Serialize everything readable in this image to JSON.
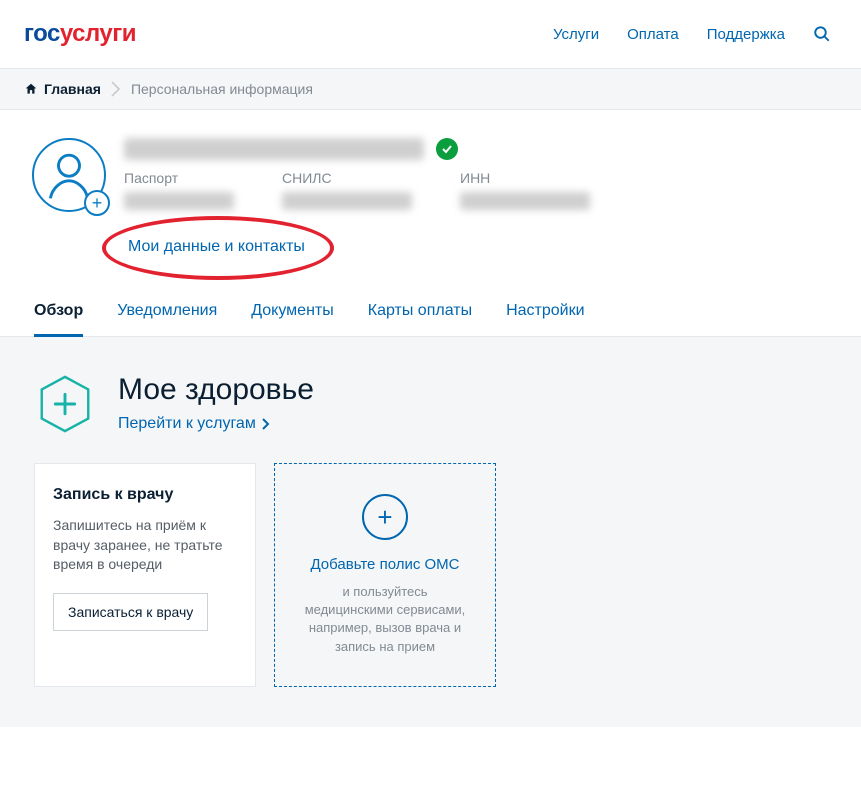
{
  "header": {
    "logo_gos": "гос",
    "logo_uslugi": "услуги",
    "nav": {
      "services": "Услуги",
      "payment": "Оплата",
      "support": "Поддержка"
    }
  },
  "breadcrumb": {
    "home": "Главная",
    "current": "Персональная информация"
  },
  "profile": {
    "docs": {
      "passport_label": "Паспорт",
      "snils_label": "СНИЛС",
      "inn_label": "ИНН"
    },
    "data_link": "Мои данные и контакты"
  },
  "tabs": {
    "overview": "Обзор",
    "notifications": "Уведомления",
    "documents": "Документы",
    "payment_cards": "Карты оплаты",
    "settings": "Настройки"
  },
  "health": {
    "title": "Мое здоровье",
    "link": "Перейти к услугам",
    "card_appointment": {
      "title": "Запись к врачу",
      "desc": "Запишитесь на приём к врачу заранее, не тратьте время в очереди",
      "button": "Записаться к врачу"
    },
    "card_oms": {
      "title": "Добавьте полис ОМС",
      "desc": "и пользуйтесь медицинскими сервисами, например, вызов врача и запись на прием"
    }
  }
}
